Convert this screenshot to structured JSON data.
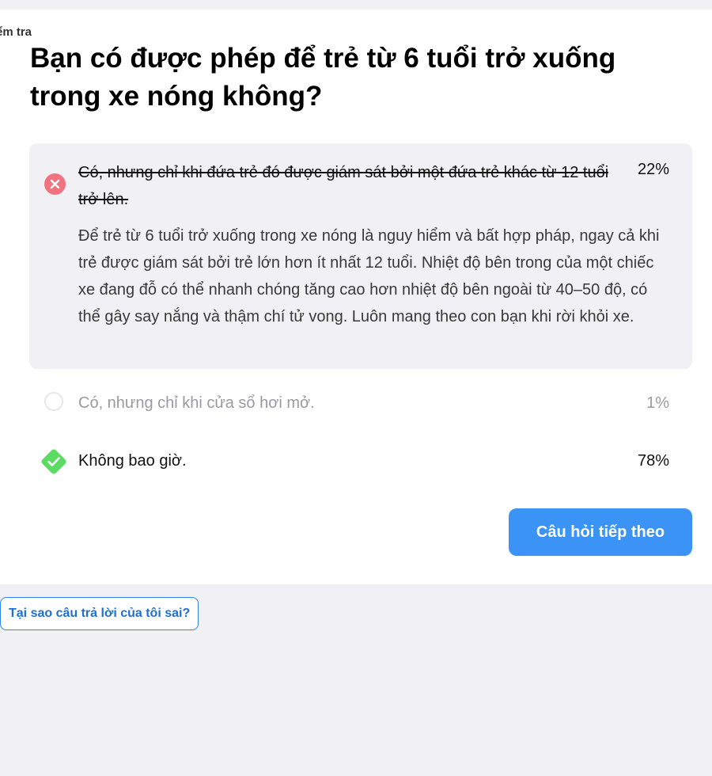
{
  "breadcrumb": "Bài kiểm tra",
  "question": "Bạn có được phép để trẻ từ 6 tuổi trở xuống trong xe nóng không?",
  "answers": [
    {
      "text": "Có, nhưng chỉ khi đứa trẻ đó được giám sát bởi một đứa trẻ khác từ 12 tuổi trở lên.",
      "percent": "22%",
      "state": "selected-wrong",
      "explanation": "Để trẻ từ 6 tuổi trở xuống trong xe nóng là nguy hiểm và bất hợp pháp, ngay cả khi trẻ được giám sát bởi trẻ lớn hơn ít nhất 12 tuổi. Nhiệt độ bên trong của một chiếc xe đang đỗ có thể nhanh chóng tăng cao hơn nhiệt độ bên ngoài từ 40–50 độ, có thể gây say nắng và thậm chí tử vong. Luôn mang theo con bạn khi rời khỏi xe."
    },
    {
      "text": "Có, nhưng chỉ khi cửa sổ hơi mở.",
      "percent": "1%",
      "state": "unselected"
    },
    {
      "text": "Không bao giờ.",
      "percent": "78%",
      "state": "correct"
    }
  ],
  "next_button_label": "Câu hỏi tiếp theo",
  "why_wrong_link": "Tại sao câu trả lời của tôi sai?",
  "icons": {
    "wrong": "x-circle-icon",
    "correct": "check-diamond-icon",
    "unselected": "radio-empty-icon"
  },
  "colors": {
    "wrong_icon": "#f0737f",
    "correct_icon": "#5bdb62",
    "primary_button": "#3a93f5",
    "link": "#1f6fd6",
    "page_background": "#f0f0f5"
  }
}
